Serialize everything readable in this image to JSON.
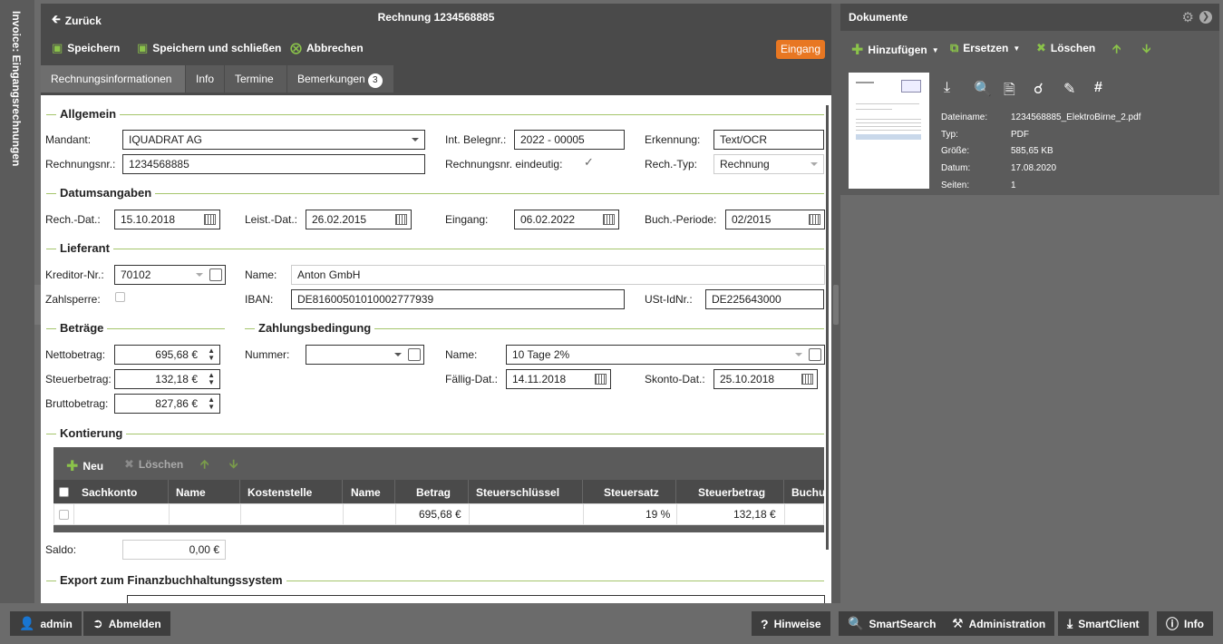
{
  "sidebar": {
    "vertical_title": "Invoice: Eingangsrechnungen"
  },
  "header": {
    "back_label": "Zurück",
    "title": "Rechnung 1234568885"
  },
  "toolbar": {
    "save_label": "Speichern",
    "save_close_label": "Speichern und schließen",
    "cancel_label": "Abbrechen",
    "status_badge": "Eingang"
  },
  "tabs": [
    {
      "label": "Rechnungsinformationen"
    },
    {
      "label": "Info"
    },
    {
      "label": "Termine"
    },
    {
      "label": "Bemerkungen",
      "count": "3"
    }
  ],
  "allgemein": {
    "title": "Allgemein",
    "mandant_label": "Mandant:",
    "mandant_value": "IQUADRAT AG",
    "belegnr_label": "Int. Belegnr.:",
    "belegnr_value": "2022 - 00005",
    "erkennung_label": "Erkennung:",
    "erkennung_value": "Text/OCR",
    "rechnungsnr_label": "Rechnungsnr.:",
    "rechnungsnr_value": "1234568885",
    "eindeutig_label": "Rechnungsnr. eindeutig:",
    "rechtyp_label": "Rech.-Typ:",
    "rechtyp_value": "Rechnung"
  },
  "datum": {
    "title": "Datumsangaben",
    "rechdat_label": "Rech.-Dat.:",
    "rechdat_value": "15.10.2018",
    "leistdat_label": "Leist.-Dat.:",
    "leistdat_value": "26.02.2015",
    "eingang_label": "Eingang:",
    "eingang_value": "06.02.2022",
    "buchperiode_label": "Buch.-Periode:",
    "buchperiode_value": "02/2015"
  },
  "lieferant": {
    "title": "Lieferant",
    "kreditor_label": "Kreditor-Nr.:",
    "kreditor_value": "70102",
    "name_label": "Name:",
    "name_value": "Anton GmbH",
    "zahlsperre_label": "Zahlsperre:",
    "iban_label": "IBAN:",
    "iban_value": "DE81600501010002777939",
    "ust_label": "USt-IdNr.:",
    "ust_value": "DE225643000"
  },
  "betraege": {
    "title": "Beträge",
    "netto_label": "Nettobetrag:",
    "netto_value": "695,68 €",
    "steuer_label": "Steuerbetrag:",
    "steuer_value": "132,18 €",
    "brutto_label": "Bruttobetrag:",
    "brutto_value": "827,86 €"
  },
  "zahlung": {
    "title": "Zahlungsbedingung",
    "nummer_label": "Nummer:",
    "nummer_value": "",
    "name_label": "Name:",
    "name_value": "10 Tage 2%",
    "faellig_label": "Fällig-Dat.:",
    "faellig_value": "14.11.2018",
    "skonto_label": "Skonto-Dat.:",
    "skonto_value": "25.10.2018"
  },
  "kontierung": {
    "title": "Kontierung",
    "new_label": "Neu",
    "delete_label": "Löschen",
    "columns": [
      "Sachkonto",
      "Name",
      "Kostenstelle",
      "Name",
      "Betrag",
      "Steuerschlüssel",
      "Steuersatz",
      "Steuerbetrag",
      "Buchu"
    ],
    "row": {
      "betrag": "695,68 €",
      "steuersatz": "19 %",
      "steuerbetrag": "132,18 €"
    },
    "saldo_label": "Saldo:",
    "saldo_value": "0,00 €"
  },
  "export": {
    "title": "Export zum Finanzbuchhaltungssystem"
  },
  "documents": {
    "title": "Dokumente",
    "add_label": "Hinzufügen",
    "replace_label": "Ersetzen",
    "delete_label": "Löschen",
    "meta": [
      {
        "key": "Dateiname:",
        "value": "1234568885_ElektroBirne_2.pdf"
      },
      {
        "key": "Typ:",
        "value": "PDF"
      },
      {
        "key": "Größe:",
        "value": "585,65 KB"
      },
      {
        "key": "Datum:",
        "value": "17.08.2020"
      },
      {
        "key": "Seiten:",
        "value": "1"
      }
    ]
  },
  "bottom": {
    "user_label": "admin",
    "logout_label": "Abmelden",
    "hints_label": "Hinweise",
    "smartsearch_label": "SmartSearch",
    "admin_label": "Administration",
    "smartclient_label": "SmartClient",
    "info_label": "Info"
  },
  "colors": {
    "accent_green": "#8bc34a",
    "badge_orange": "#e87722",
    "dark_panel": "#4a4a4a"
  }
}
